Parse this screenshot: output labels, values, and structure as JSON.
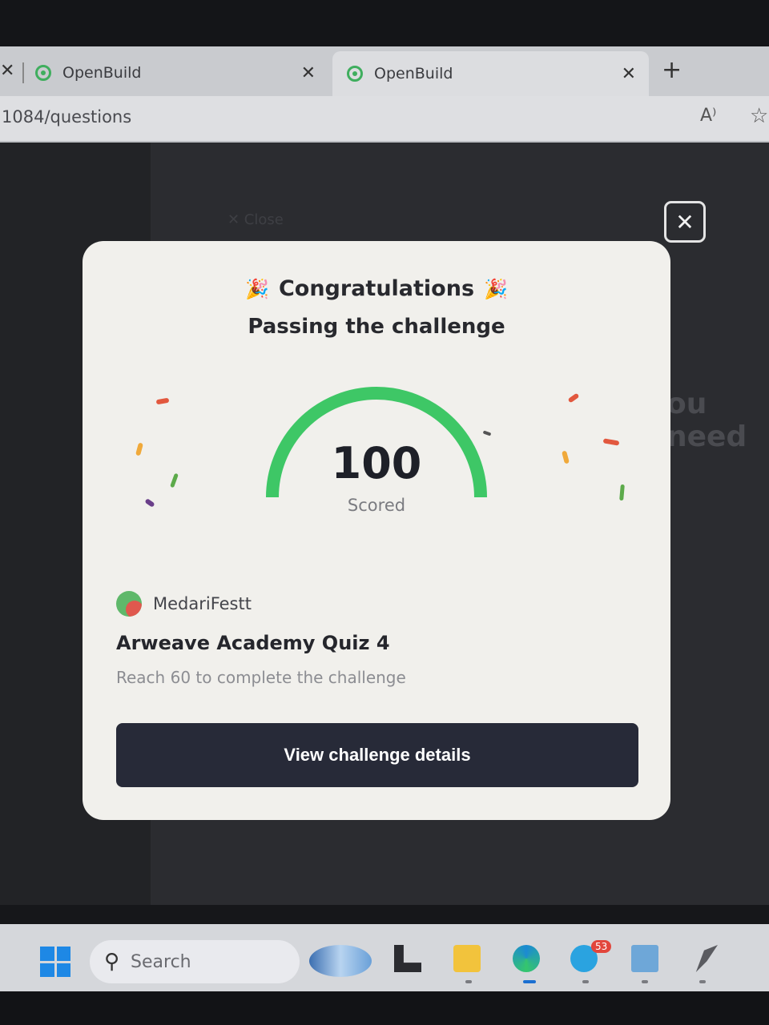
{
  "browser": {
    "tabs": [
      {
        "label": "OpenBuild",
        "active": false
      },
      {
        "label": "OpenBuild",
        "active": true
      }
    ],
    "url": "1084/questions",
    "read_aloud_label": "A⁾"
  },
  "backdrop": {
    "close_label": "✕  Close",
    "partial_text": "ou need"
  },
  "modal": {
    "title": "Congratulations",
    "subtitle": "Passing the challenge",
    "score": "100",
    "score_label": "Scored",
    "score_value": 100,
    "score_max": 100,
    "gauge_color": "#3ec766",
    "user": "MedariFestt",
    "quiz_title": "Arweave Academy Quiz 4",
    "requirement": "Reach 60 to complete the challenge",
    "cta_label": "View challenge details"
  },
  "taskbar": {
    "search_label": "Search",
    "telegram_badge": "53"
  }
}
